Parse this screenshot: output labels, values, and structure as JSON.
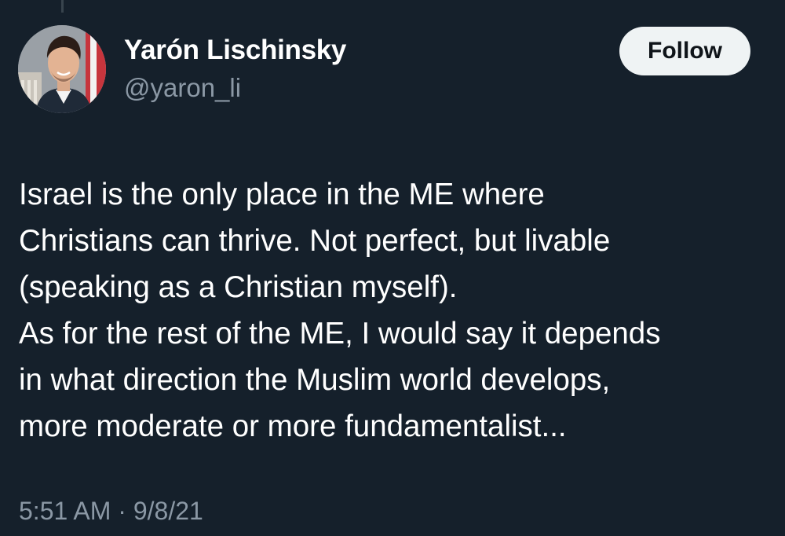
{
  "author": {
    "display_name": "Yarón Lischinsky",
    "handle": "@yaron_li",
    "avatar_icon": "profile-photo"
  },
  "follow_button": {
    "label": "Follow"
  },
  "tweet": {
    "lines": [
      "Israel is the only place in the ME where",
      "Christians can thrive. Not perfect, but livable",
      "(speaking as a Christian myself).",
      "As for the rest of the ME, I would say it depends",
      "in what direction the Muslim world develops,",
      "more moderate or more fundamentalist..."
    ],
    "time": "5:51 AM",
    "separator": "·",
    "date": "9/8/21"
  },
  "colors": {
    "background": "#15202b",
    "text_primary": "#ffffff",
    "text_secondary": "#8b98a5",
    "button_bg": "#eff3f4",
    "button_text": "#0f1419"
  }
}
